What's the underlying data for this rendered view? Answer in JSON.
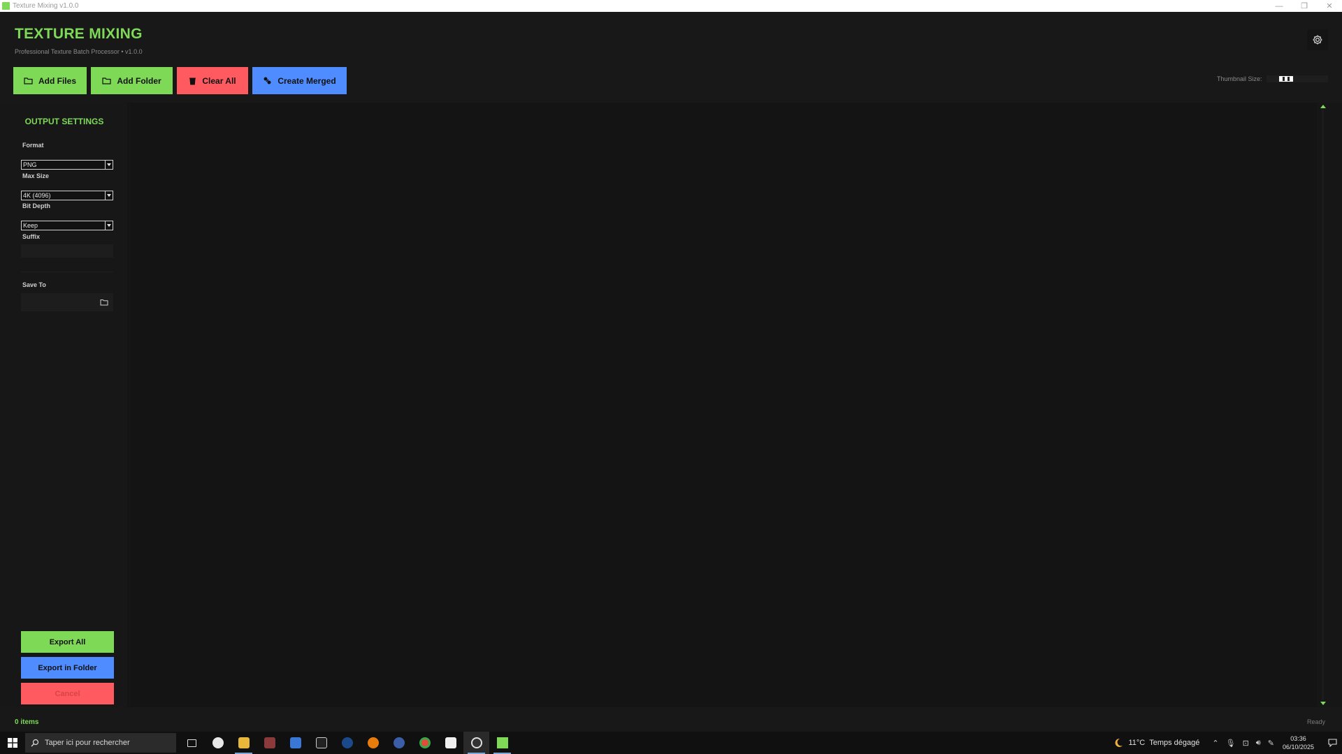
{
  "window": {
    "title": "Texture Mixing v1.0.0",
    "minimize": "—",
    "maximize": "❐",
    "close": "✕"
  },
  "header": {
    "app_title": "TEXTURE MIXING",
    "subtitle": "Professional Texture Batch Processor  •  v1.0.0",
    "buttons": {
      "add_files": "Add Files",
      "add_folder": "Add Folder",
      "clear_all": "Clear All",
      "create_merged": "Create Merged"
    },
    "thumbnail_label": "Thumbnail Size:",
    "thumbnail_level": 0.25
  },
  "sidebar": {
    "title": "OUTPUT SETTINGS",
    "format_label": "Format",
    "format_value": "PNG",
    "max_size_label": "Max Size",
    "max_size_value": "4K (4096)",
    "bit_depth_label": "Bit Depth",
    "bit_depth_value": "Keep",
    "suffix_label": "Suffix",
    "suffix_value": "",
    "save_to_label": "Save To",
    "save_to_value": "",
    "export_all": "Export All",
    "export_in_folder": "Export in Folder",
    "cancel": "Cancel"
  },
  "status": {
    "count": "0 items",
    "state": "Ready"
  },
  "taskbar": {
    "search_placeholder": "Taper ici pour rechercher",
    "weather_temp": "11°C",
    "weather_desc": "Temps dégagé",
    "time": "03:36",
    "date": "06/10/2025"
  },
  "colors": {
    "accent_green": "#7ed957",
    "accent_red": "#ff5a5f",
    "accent_blue": "#4f8cff",
    "background": "#161616"
  }
}
